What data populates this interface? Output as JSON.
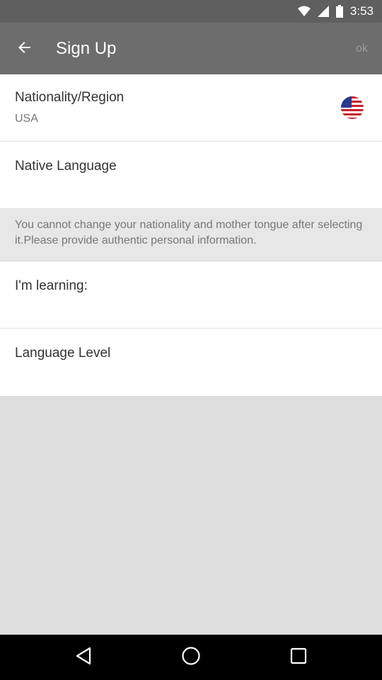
{
  "status_bar": {
    "time": "3:53"
  },
  "app_bar": {
    "title": "Sign Up",
    "ok_label": "ok"
  },
  "nationality": {
    "label": "Nationality/Region",
    "value": "USA",
    "flag": "usa-flag-icon"
  },
  "native_language": {
    "label": "Native Language"
  },
  "notice": {
    "text": "You cannot change your nationality and mother tongue after selecting it.Please provide authentic personal information."
  },
  "learning": {
    "label": "I'm learning:"
  },
  "language_level": {
    "label": "Language Level"
  },
  "colors": {
    "app_bar": "#6d6d6d",
    "status_bar": "#5f5f5f",
    "background": "#dedede"
  }
}
